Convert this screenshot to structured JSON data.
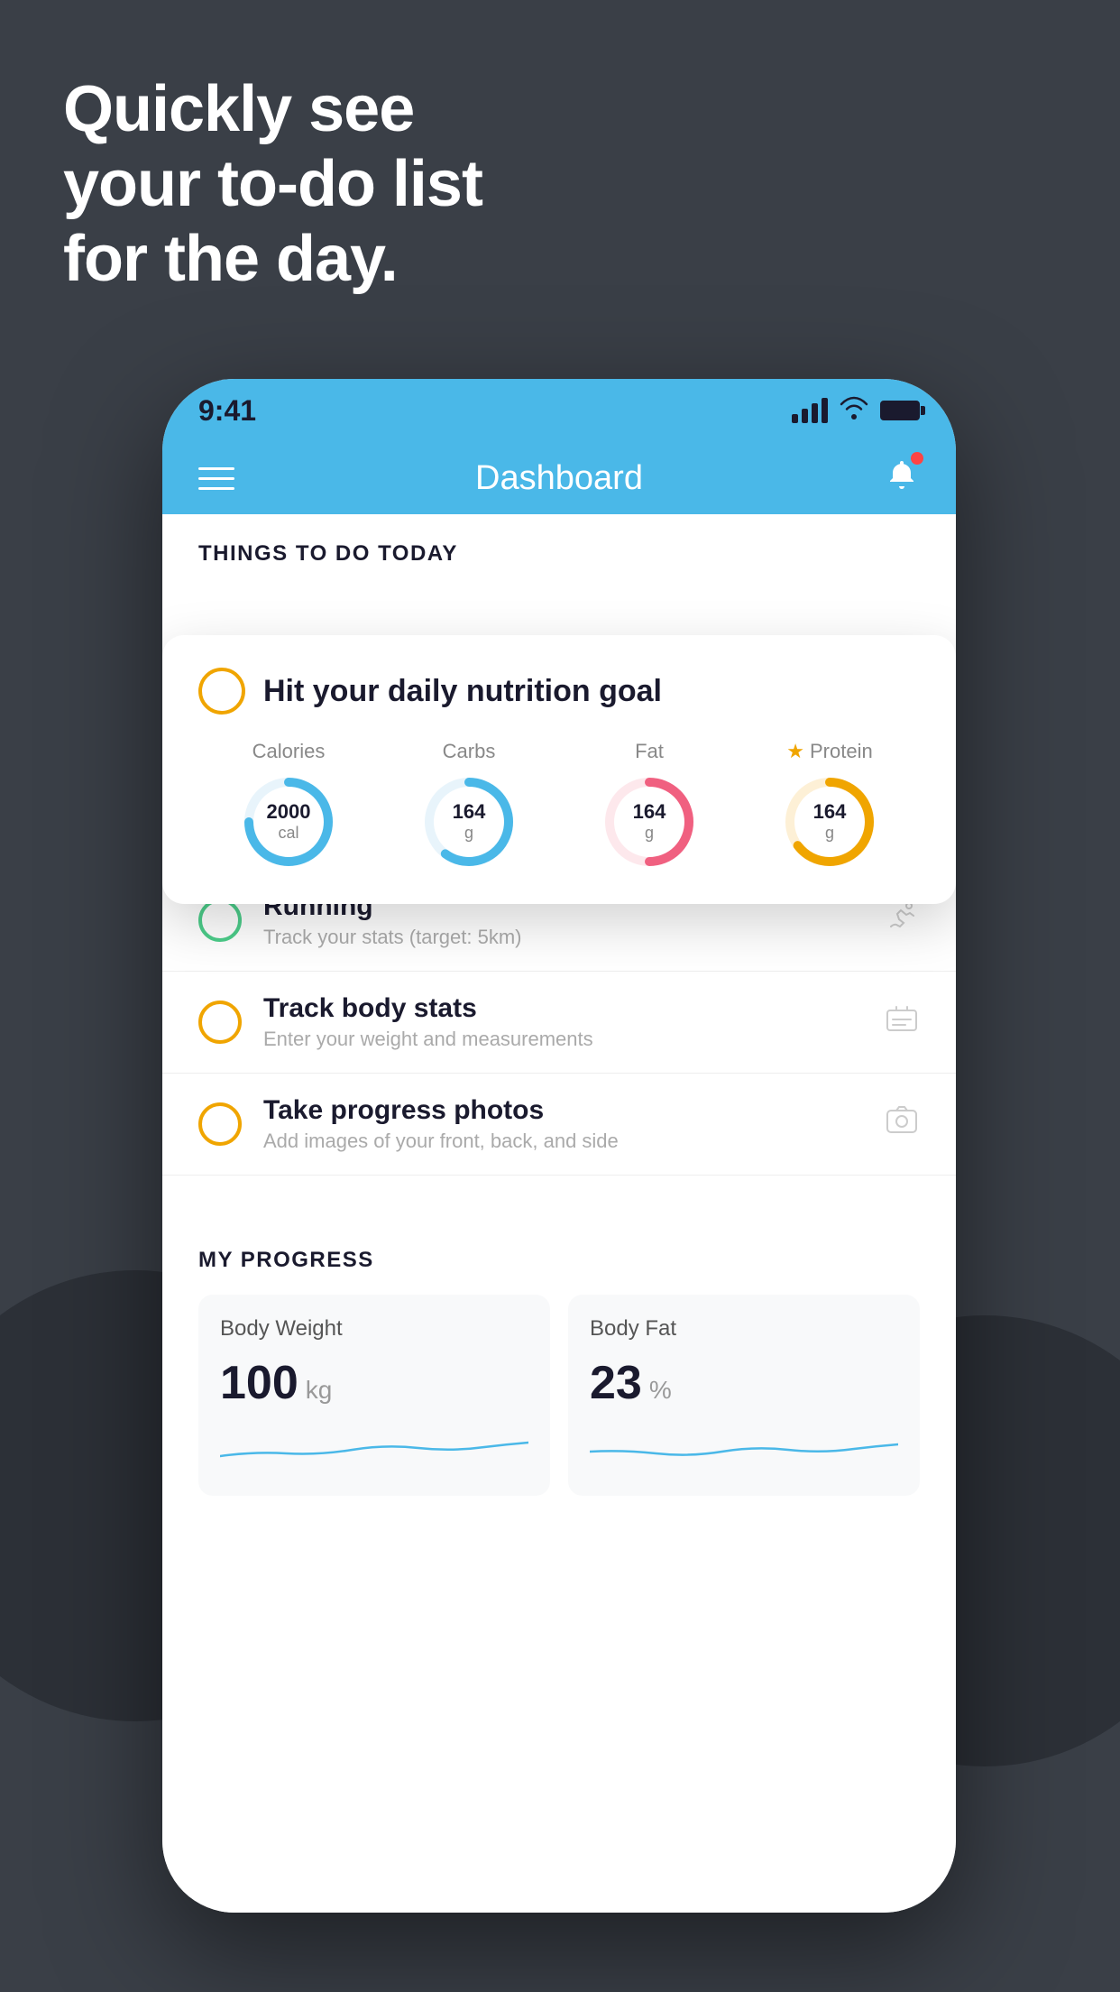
{
  "hero": {
    "line1": "Quickly see",
    "line2": "your to-do list",
    "line3": "for the day."
  },
  "status_bar": {
    "time": "9:41"
  },
  "nav": {
    "title": "Dashboard"
  },
  "things_section": {
    "header": "THINGS TO DO TODAY"
  },
  "floating_card": {
    "title": "Hit your daily nutrition goal",
    "nutrition": [
      {
        "label": "Calories",
        "value": "2000",
        "unit": "cal",
        "color": "#4ab8e8",
        "track": 75
      },
      {
        "label": "Carbs",
        "value": "164",
        "unit": "g",
        "color": "#4ab8e8",
        "track": 60
      },
      {
        "label": "Fat",
        "value": "164",
        "unit": "g",
        "color": "#f06080",
        "track": 50
      },
      {
        "label": "Protein",
        "value": "164",
        "unit": "g",
        "color": "#f0a500",
        "track": 65,
        "star": true
      }
    ]
  },
  "todo_items": [
    {
      "title": "Running",
      "subtitle": "Track your stats (target: 5km)",
      "circle_color": "green",
      "icon": "👟"
    },
    {
      "title": "Track body stats",
      "subtitle": "Enter your weight and measurements",
      "circle_color": "yellow",
      "icon": "⚖"
    },
    {
      "title": "Take progress photos",
      "subtitle": "Add images of your front, back, and side",
      "circle_color": "yellow-2",
      "icon": "🪪"
    }
  ],
  "progress": {
    "header": "MY PROGRESS",
    "cards": [
      {
        "title": "Body Weight",
        "value": "100",
        "unit": "kg"
      },
      {
        "title": "Body Fat",
        "value": "23",
        "unit": "%"
      }
    ]
  }
}
